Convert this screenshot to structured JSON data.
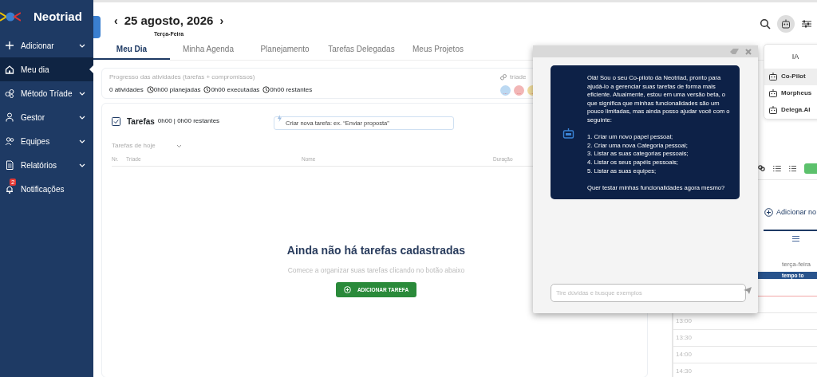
{
  "sidebar": {
    "brand": "Neotriad",
    "items": [
      {
        "label": "Adicionar",
        "has_submenu": true,
        "selected": false
      },
      {
        "label": "Meu dia",
        "has_submenu": false,
        "selected": true
      },
      {
        "label": "Método Tríade",
        "has_submenu": true,
        "selected": false
      },
      {
        "label": "Gestor",
        "has_submenu": true,
        "selected": false
      },
      {
        "label": "Equipes",
        "has_submenu": true,
        "selected": false
      },
      {
        "label": "Relatórios",
        "has_submenu": true,
        "selected": false
      },
      {
        "label": "Notificações",
        "has_submenu": false,
        "selected": false,
        "badge": "2"
      }
    ]
  },
  "date_nav": {
    "prev": "‹",
    "date": "25 agosto, 2026",
    "next": "›",
    "weekday": "Terça-Feira"
  },
  "tabs": [
    {
      "label": "Meu Dia",
      "selected": true
    },
    {
      "label": "Minha Agenda",
      "selected": false
    },
    {
      "label": "Planejamento",
      "selected": false
    },
    {
      "label": "Tarefas Delegadas",
      "selected": false
    },
    {
      "label": "Meus Projetos",
      "selected": false
    }
  ],
  "progress": {
    "title": "Progresso das atividades (tarefas + compromissos)",
    "activities": "0 atividades",
    "stats": [
      "0h00 planejadas",
      "0h00 executadas",
      "0h00 restantes"
    ],
    "triade_label": "tríade",
    "triade_dots": [
      {
        "label": "...",
        "color": "#bcd9f2"
      },
      {
        "label": "...",
        "color": "#f2b6b6"
      },
      {
        "label": "...",
        "color": "#f4df9f"
      }
    ]
  },
  "tasks": {
    "title": "Tarefas",
    "summary": "0h00 | 0h00 restantes",
    "new_task": {
      "placeholder": "Criar nova tarefa: ex. “Enviar proposta”"
    },
    "filter": "Tarefas de hoje",
    "columns": [
      "Nr.",
      "Tríade",
      "Nome",
      "Duração"
    ],
    "empty_title": "Ainda não há tarefas cadastradas",
    "empty_hint": "Comece a organizar suas tarefas clicando no botão abaixo",
    "add_button": "ADICIONAR TAREFA"
  },
  "ai_menu": {
    "title": "IA",
    "items": [
      {
        "label": "Co-Pilot",
        "selected": true
      },
      {
        "label": "Morpheus",
        "selected": false
      },
      {
        "label": "Delega.AI",
        "selected": false
      }
    ]
  },
  "chat": {
    "intro": "Olá! Sou o seu Co-piloto da Neotriad, pronto para ajudá-lo a gerenciar suas tarefas de forma mais eficiente. Atualmente, estou em uma versão beta, o que significa que minhas funcionalidades são um pouco limitadas, mas ainda posso ajudar você com o seguinte:",
    "options": [
      "1. Criar um novo papel pessoal;",
      "2. Criar uma nova Categoria pessoal;",
      "3. Listar as suas categorias pessoais;",
      "4. Listar os seus papéis pessoais;",
      "5. Listar as suas equipes;"
    ],
    "question": "Quer testar minhas funcionalidades agora mesmo?",
    "input": {
      "placeholder": "Tire dúvidas e busque exemplos"
    }
  },
  "right_panel": {
    "add_label": "Adicionar no",
    "day": "terça-feira",
    "banner": "tempo to",
    "times": [
      "13:00",
      "13:30",
      "14:00",
      "14:30"
    ]
  }
}
